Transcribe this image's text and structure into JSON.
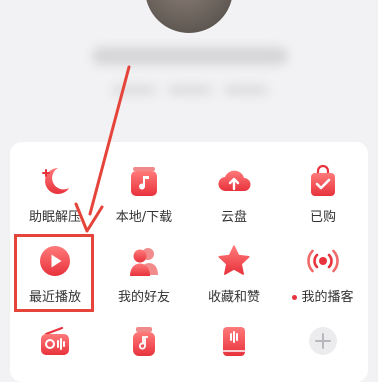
{
  "menu": {
    "row1": [
      {
        "label": "助眠解压",
        "icon": "moon-icon"
      },
      {
        "label": "本地/下载",
        "icon": "music-note-icon"
      },
      {
        "label": "云盘",
        "icon": "cloud-upload-icon"
      },
      {
        "label": "已购",
        "icon": "shopping-bag-icon"
      }
    ],
    "row2": [
      {
        "label": "最近播放",
        "icon": "play-icon"
      },
      {
        "label": "我的好友",
        "icon": "friends-icon"
      },
      {
        "label": "收藏和赞",
        "icon": "star-icon"
      },
      {
        "label": "我的播客",
        "icon": "broadcast-icon"
      }
    ],
    "row3": [
      {
        "icon": "radio-icon"
      },
      {
        "icon": "music-jar-icon"
      },
      {
        "icon": "book-icon"
      },
      {
        "icon": "add-icon"
      }
    ]
  },
  "colors": {
    "accent": "#e8323c",
    "annotation": "#e5443a"
  }
}
